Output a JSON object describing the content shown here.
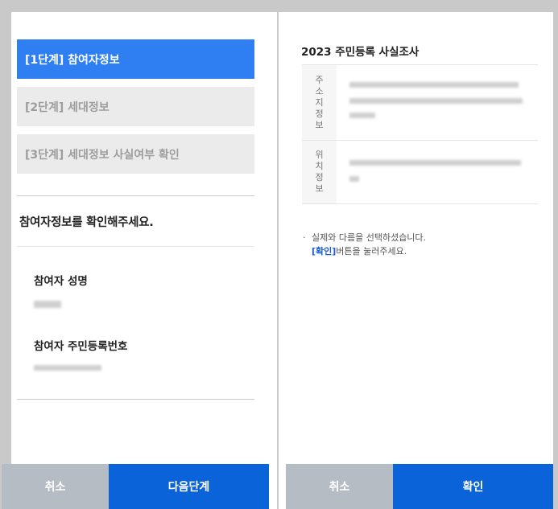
{
  "left": {
    "steps": [
      {
        "label": "[1단계] 참여자정보",
        "active": true
      },
      {
        "label": "[2단계] 세대정보",
        "active": false
      },
      {
        "label": "[3단계] 세대정보 사실여부 확인",
        "active": false
      }
    ],
    "question": "참여자정보를 확인해주세요.",
    "name_label": "참여자 성명",
    "rrn_label": "참여자 주민등록번호",
    "cancel_label": "취소",
    "next_label": "다음단계"
  },
  "right": {
    "title": "2023 주민등록 사실조사",
    "rows": [
      {
        "header": [
          "주",
          "소",
          "지",
          "정",
          "보"
        ]
      },
      {
        "header": [
          "위",
          "치",
          "정",
          "보"
        ]
      }
    ],
    "notice_line1": "실제와 다름을 선택하셨습니다.",
    "notice_hl": "[확인]",
    "notice_line2": "버튼을 눌러주세요.",
    "cancel_label": "취소",
    "confirm_label": "확인"
  },
  "colors": {
    "active_step": "#2f7ff3",
    "primary_button": "#0a63d8",
    "cancel_button": "#b6bcc4",
    "highlight_text": "#1a5ed9"
  }
}
